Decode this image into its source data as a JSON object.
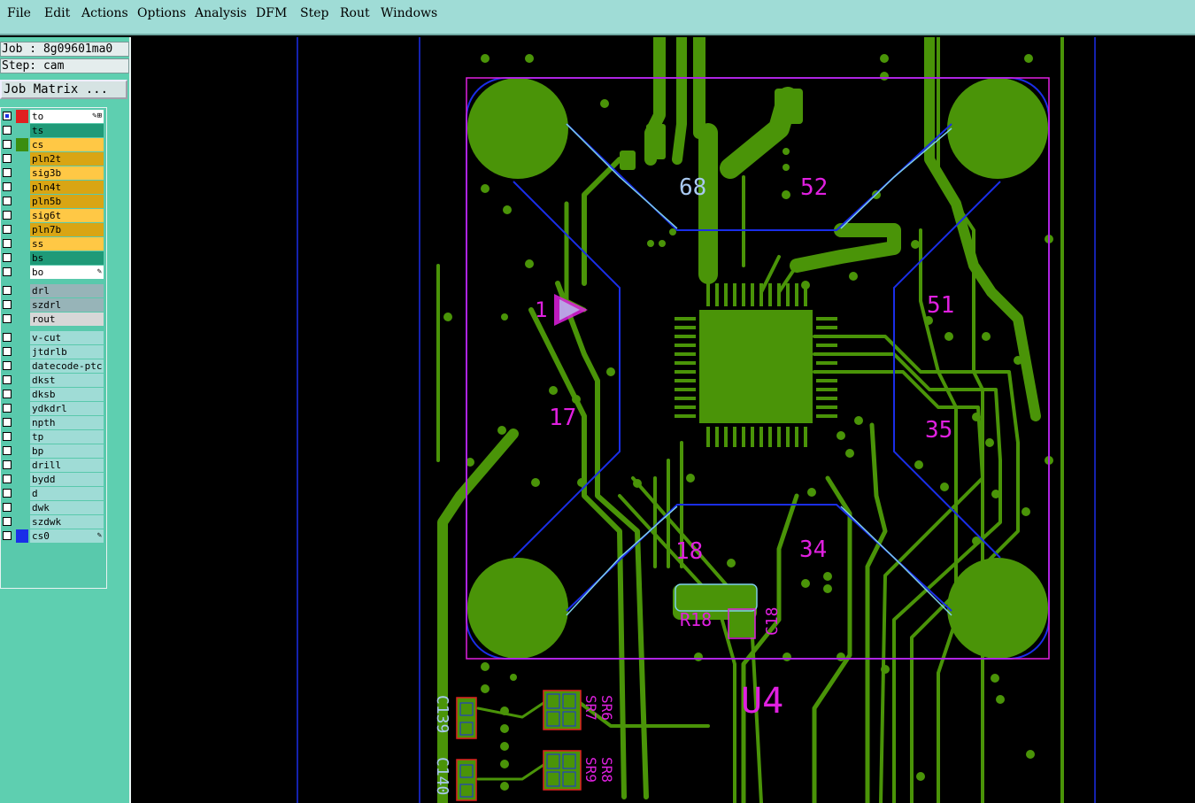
{
  "menu": [
    "File",
    "Edit",
    "Actions",
    "Options",
    "Analysis",
    "DFM",
    "Step",
    "Rout",
    "Windows"
  ],
  "job_label": "Job : 8g09601ma0",
  "step_label": "Step: cam",
  "matrix_button": "Job Matrix ...",
  "layers": [
    {
      "name": "to",
      "bg": "#ffffff",
      "swatch": "#e02020",
      "checked": true,
      "marker": "✎⊞"
    },
    {
      "name": "ts",
      "bg": "#1f9a78",
      "swatch": null,
      "checked": false,
      "marker": ""
    },
    {
      "name": "cs",
      "bg": "#ffc845",
      "swatch": "#3b8e10",
      "checked": false,
      "marker": ""
    },
    {
      "name": "pln2t",
      "bg": "#d9a514",
      "swatch": null,
      "checked": false,
      "marker": ""
    },
    {
      "name": "sig3b",
      "bg": "#ffc845",
      "swatch": null,
      "checked": false,
      "marker": ""
    },
    {
      "name": "pln4t",
      "bg": "#d9a514",
      "swatch": null,
      "checked": false,
      "marker": ""
    },
    {
      "name": "pln5b",
      "bg": "#d9a514",
      "swatch": null,
      "checked": false,
      "marker": ""
    },
    {
      "name": "sig6t",
      "bg": "#ffc845",
      "swatch": null,
      "checked": false,
      "marker": ""
    },
    {
      "name": "pln7b",
      "bg": "#d9a514",
      "swatch": null,
      "checked": false,
      "marker": ""
    },
    {
      "name": "ss",
      "bg": "#ffc845",
      "swatch": null,
      "checked": false,
      "marker": ""
    },
    {
      "name": "bs",
      "bg": "#1f9a78",
      "swatch": null,
      "checked": false,
      "marker": ""
    },
    {
      "name": "bo",
      "bg": "#ffffff",
      "swatch": null,
      "checked": false,
      "marker": "✎"
    },
    {
      "name": "drl",
      "bg": "#97b4b8",
      "swatch": null,
      "checked": false,
      "marker": ""
    },
    {
      "name": "szdrl",
      "bg": "#97b4b8",
      "swatch": null,
      "checked": false,
      "marker": ""
    },
    {
      "name": "rout",
      "bg": "#d7d7d7",
      "swatch": null,
      "checked": false,
      "marker": ""
    },
    {
      "name": "v-cut",
      "bg": "#9fdcd6",
      "swatch": null,
      "checked": false,
      "marker": ""
    },
    {
      "name": "jtdrlb",
      "bg": "#9fdcd6",
      "swatch": null,
      "checked": false,
      "marker": ""
    },
    {
      "name": "datecode-ptc",
      "bg": "#9fdcd6",
      "swatch": null,
      "checked": false,
      "marker": ""
    },
    {
      "name": "dkst",
      "bg": "#9fdcd6",
      "swatch": null,
      "checked": false,
      "marker": ""
    },
    {
      "name": "dksb",
      "bg": "#9fdcd6",
      "swatch": null,
      "checked": false,
      "marker": ""
    },
    {
      "name": "ydkdrl",
      "bg": "#9fdcd6",
      "swatch": null,
      "checked": false,
      "marker": ""
    },
    {
      "name": "npth",
      "bg": "#9fdcd6",
      "swatch": null,
      "checked": false,
      "marker": ""
    },
    {
      "name": "tp",
      "bg": "#9fdcd6",
      "swatch": null,
      "checked": false,
      "marker": ""
    },
    {
      "name": "bp",
      "bg": "#9fdcd6",
      "swatch": null,
      "checked": false,
      "marker": ""
    },
    {
      "name": "drill",
      "bg": "#9fdcd6",
      "swatch": null,
      "checked": false,
      "marker": ""
    },
    {
      "name": "bydd",
      "bg": "#9fdcd6",
      "swatch": null,
      "checked": false,
      "marker": ""
    },
    {
      "name": "d",
      "bg": "#9fdcd6",
      "swatch": null,
      "checked": false,
      "marker": ""
    },
    {
      "name": "dwk",
      "bg": "#9fdcd6",
      "swatch": null,
      "checked": false,
      "marker": ""
    },
    {
      "name": "szdwk",
      "bg": "#9fdcd6",
      "swatch": null,
      "checked": false,
      "marker": ""
    },
    {
      "name": "cs0",
      "bg": "#9fdcd6",
      "swatch": "#1a2ee8",
      "checked": false,
      "marker": "✎"
    }
  ],
  "board_labels": {
    "pin_68": "68",
    "pin_52": "52",
    "pin_1": "1",
    "pin_51": "51",
    "pin_17": "17",
    "pin_35": "35",
    "pin_18": "18",
    "pin_34": "34",
    "ref_u4": "U4",
    "ref_r18": "R18",
    "ref_c18": "C18",
    "ref_c139": "C139",
    "ref_c140": "C140",
    "ref_sr7": "SR7",
    "ref_sr6": "SR6",
    "ref_sr9": "SR9",
    "ref_sr8": "SR8"
  },
  "colors": {
    "copper": "#4a9408",
    "silk_pink": "#e020e0",
    "outline_blue": "#1a2ee8",
    "silk_cyan": "#7fd0e8",
    "pad_red": "#e02020"
  }
}
